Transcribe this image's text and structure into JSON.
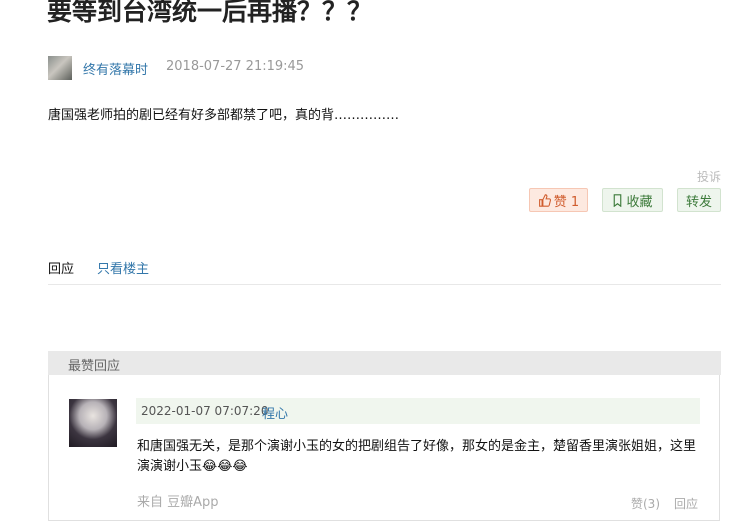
{
  "post": {
    "title": "要等到台湾统一后再播？？？",
    "author": "终有落幕时",
    "time": "2018-07-27 21:19:45",
    "content": "唐国强老师拍的剧已经有好多部都禁了吧，真的背……………",
    "report": "投诉"
  },
  "actions": {
    "like_label": "赞 1",
    "fav_label": "收藏",
    "share_label": "转发"
  },
  "tabs": {
    "reply": "回应",
    "op_only": "只看楼主"
  },
  "best": {
    "title": "最赞回应",
    "comment": {
      "time": "2022-01-07 07:07:20",
      "author": "程心",
      "text": "和唐国强无关，是那个演谢小玉的女的把剧组告了好像，那女的是金主，楚留香里演张姐姐，这里演演谢小玉😂😂😂",
      "source": "来自 豆瓣App",
      "like": "赞(3)",
      "reply": "回应"
    }
  },
  "colors": {
    "link": "#3377aa",
    "like_bg": "#fde9e0",
    "fav_bg": "#eef5ed"
  }
}
